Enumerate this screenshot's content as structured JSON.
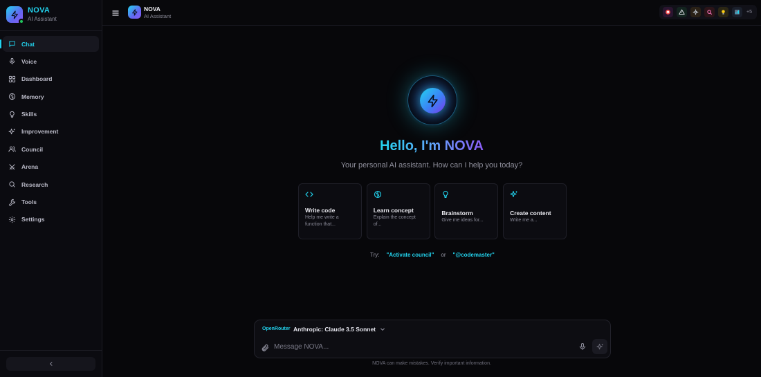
{
  "sidebar": {
    "brand_title": "NOVA",
    "brand_subtitle": "AI Assistant",
    "items": [
      {
        "label": "Chat",
        "icon": "chat-icon",
        "active": true
      },
      {
        "label": "Voice",
        "icon": "mic-icon"
      },
      {
        "label": "Dashboard",
        "icon": "grid-icon"
      },
      {
        "label": "Memory",
        "icon": "brain-icon"
      },
      {
        "label": "Skills",
        "icon": "lightbulb-icon"
      },
      {
        "label": "Improvement",
        "icon": "sparkles-icon"
      },
      {
        "label": "Council",
        "icon": "users-icon"
      },
      {
        "label": "Arena",
        "icon": "swords-icon"
      },
      {
        "label": "Research",
        "icon": "search-icon"
      },
      {
        "label": "Tools",
        "icon": "wrench-icon"
      },
      {
        "label": "Settings",
        "icon": "gear-icon"
      }
    ],
    "collapse_icon": "chevron-left-icon"
  },
  "header": {
    "title": "NOVA",
    "subtitle": "AI Assistant",
    "more_agents": "+5",
    "agent_icons": [
      "target-icon",
      "alert-icon",
      "gear-icon",
      "search-icon",
      "lightbulb-icon",
      "chart-icon"
    ]
  },
  "main": {
    "greeting": "Hello, I'm NOVA",
    "tagline": "Your personal AI assistant. How can I help you today?",
    "cards": [
      {
        "title": "Write code",
        "desc": "Help me write a function that...",
        "icon": "code-icon"
      },
      {
        "title": "Learn concept",
        "desc": "Explain the concept of...",
        "icon": "brain-icon"
      },
      {
        "title": "Brainstorm",
        "desc": "Give me ideas for...",
        "icon": "lightbulb-icon"
      },
      {
        "title": "Create content",
        "desc": "Write me a...",
        "icon": "sparkles-icon"
      }
    ],
    "try_label": "Try:",
    "try_chip_1": "\"Activate council\"",
    "try_or": "or",
    "try_chip_2": "\"@codemaster\""
  },
  "composer": {
    "provider": "OpenRouter",
    "model": "Anthropic: Claude 3.5 Sonnet",
    "placeholder": "Message NOVA...",
    "disclaimer": "NOVA can make mistakes. Verify important information."
  },
  "colors": {
    "accent": "#22d3ee",
    "accent_purple": "#8b5cf6",
    "background": "#07070a"
  }
}
